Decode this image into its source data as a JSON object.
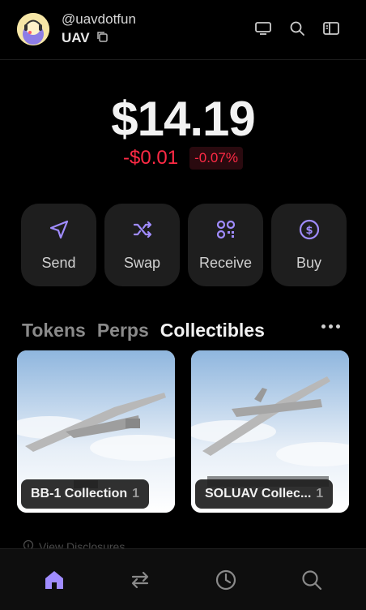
{
  "header": {
    "handle": "@uavdotfun",
    "account_name": "UAV",
    "icons": [
      "avatar",
      "copy-icon",
      "monitor-icon",
      "search-icon",
      "sidebar-icon"
    ]
  },
  "balance": {
    "amount": "$14.19",
    "change_abs": "-$0.01",
    "change_pct": "-0.07%"
  },
  "actions": [
    {
      "label": "Send",
      "icon": "send-icon"
    },
    {
      "label": "Swap",
      "icon": "swap-icon"
    },
    {
      "label": "Receive",
      "icon": "qr-icon"
    },
    {
      "label": "Buy",
      "icon": "dollar-icon"
    }
  ],
  "tabs": [
    {
      "label": "Tokens",
      "active": false
    },
    {
      "label": "Perps",
      "active": false
    },
    {
      "label": "Collectibles",
      "active": true
    }
  ],
  "collections": [
    {
      "name": "BB-1 Collection",
      "count": "1"
    },
    {
      "name": "SOLUAV Collec...",
      "count": "1"
    }
  ],
  "footer": {
    "disclosures_label": "View Disclosures"
  },
  "bottom_nav": [
    "home-icon",
    "swap-arrows-icon",
    "history-icon",
    "search-icon"
  ],
  "colors": {
    "accent": "#a08cff",
    "negative": "#ff2a45",
    "background": "#000000",
    "card": "#1e1e1e"
  }
}
